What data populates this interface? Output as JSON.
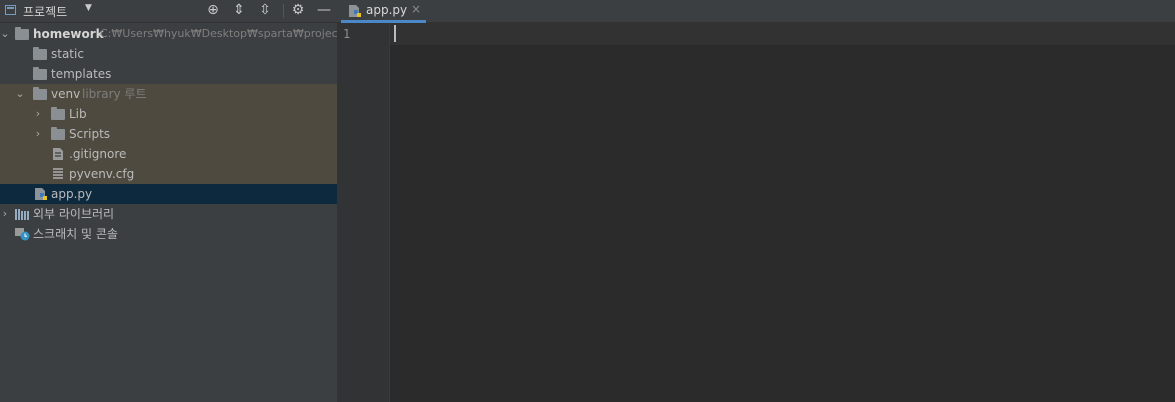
{
  "project_panel": {
    "title": "프로젝트",
    "dropdown_glyph": "▼",
    "tools": [
      {
        "name": "locate-icon",
        "glyph": "⊕"
      },
      {
        "name": "expand-all-icon",
        "glyph": "⇕"
      },
      {
        "name": "collapse-all-icon",
        "glyph": "⇳"
      },
      {
        "name": "gear-icon",
        "glyph": "⚙"
      },
      {
        "name": "minimize-icon",
        "glyph": "—"
      }
    ]
  },
  "tree": {
    "root": {
      "label": "homework",
      "path": "C:₩Users₩hyuk₩Desktop₩sparta₩projects₩"
    },
    "items": {
      "static": "static",
      "templates": "templates",
      "venv": "venv",
      "venv_note": "library 루트",
      "lib": "Lib",
      "scripts": "Scripts",
      "gitignore": ".gitignore",
      "pyvenv": "pyvenv.cfg",
      "app": "app.py",
      "external": "외부 라이브러리",
      "scratches": "스크래치 및 콘솔"
    }
  },
  "editor": {
    "tab_label": "app.py",
    "tab_close": "×",
    "line_number": "1"
  },
  "colors": {
    "panel_bg": "#3c3f41",
    "editor_bg": "#2b2b2b",
    "selection": "#0d293e",
    "venv_highlight": "#4e4a3f",
    "tab_underline": "#4a88c7"
  }
}
